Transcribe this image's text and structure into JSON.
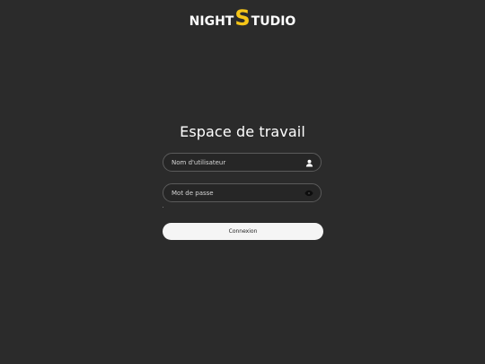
{
  "logo": {
    "part1": "NIGHT",
    "part2": "S",
    "part3": "TUDIO",
    "accent_color": "#f5c518"
  },
  "title": "Espace de travail",
  "form": {
    "username": {
      "placeholder": "Nom d'utilisateur",
      "value": "",
      "icon": "user-icon"
    },
    "password": {
      "placeholder": "Mot de passe",
      "value": "",
      "icon": "eye-icon"
    },
    "submit_label": "Connexion"
  },
  "colors": {
    "background": "#2b2b2b",
    "field_border": "#5b5b5b",
    "button_bg": "#f5f5f5"
  }
}
